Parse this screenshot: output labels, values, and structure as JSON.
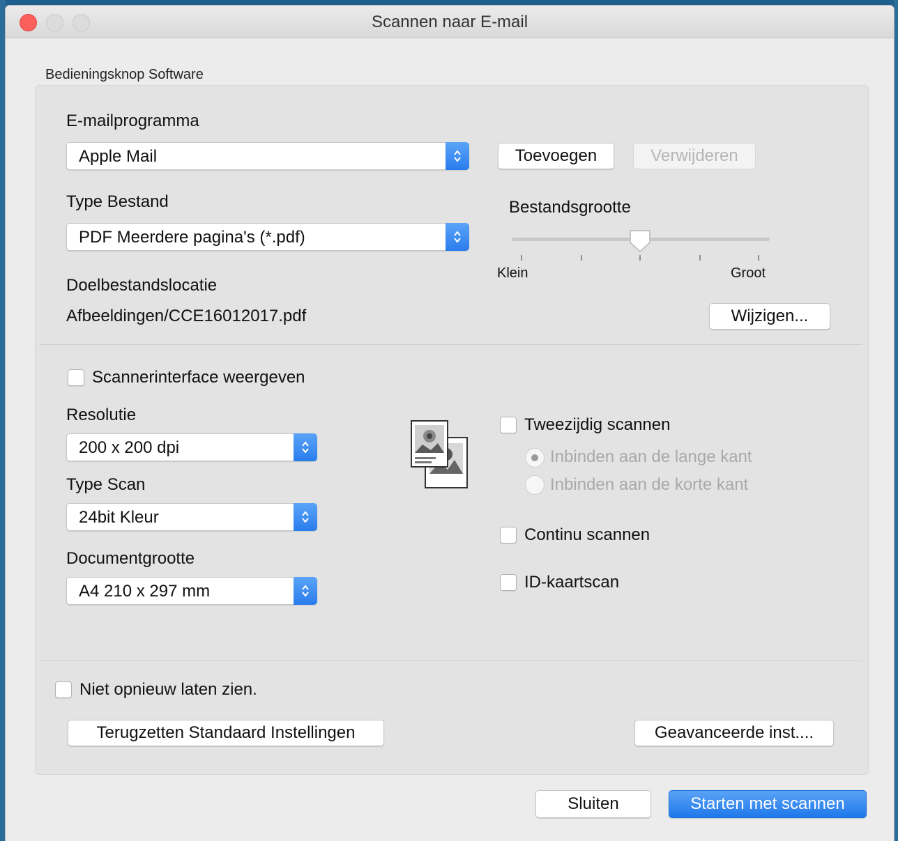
{
  "window": {
    "title": "Scannen naar E-mail"
  },
  "group": {
    "label": "Bedieningsknop Software"
  },
  "email_program": {
    "label": "E-mailprogramma",
    "selected": "Apple Mail",
    "add_label": "Toevoegen",
    "remove_label": "Verwijderen"
  },
  "file_type": {
    "label": "Type Bestand",
    "selected": "PDF Meerdere pagina's (*.pdf)"
  },
  "file_size": {
    "label": "Bestandsgrootte",
    "min_label": "Klein",
    "max_label": "Groot",
    "level": 0.5
  },
  "destination": {
    "label": "Doelbestandslocatie",
    "value": "Afbeeldingen/CCE16012017.pdf",
    "change_label": "Wijzigen..."
  },
  "scanner_interface": {
    "label": "Scannerinterface weergeven",
    "checked": false
  },
  "resolution": {
    "label": "Resolutie",
    "selected": "200 x 200 dpi"
  },
  "scan_type": {
    "label": "Type Scan",
    "selected": "24bit Kleur"
  },
  "document_size": {
    "label": "Documentgrootte",
    "selected": "A4 210 x 297 mm"
  },
  "duplex": {
    "label": "Tweezijdig scannen",
    "checked": false,
    "long_edge": "Inbinden aan de lange kant",
    "short_edge": "Inbinden aan de korte kant"
  },
  "continuous": {
    "label": "Continu scannen",
    "checked": false
  },
  "id_card": {
    "label": "ID-kaartscan",
    "checked": false
  },
  "dont_show": {
    "label": "Niet opnieuw laten zien.",
    "checked": false
  },
  "buttons": {
    "reset": "Terugzetten Standaard Instellingen",
    "advanced": "Geavanceerde inst....",
    "close": "Sluiten",
    "start": "Starten met scannen"
  },
  "icons": {
    "updown": "updown-chevron-icon",
    "document": "duplex-document-icon"
  },
  "colors": {
    "accent": "#2a7ded",
    "close_light": "#fc605c"
  }
}
